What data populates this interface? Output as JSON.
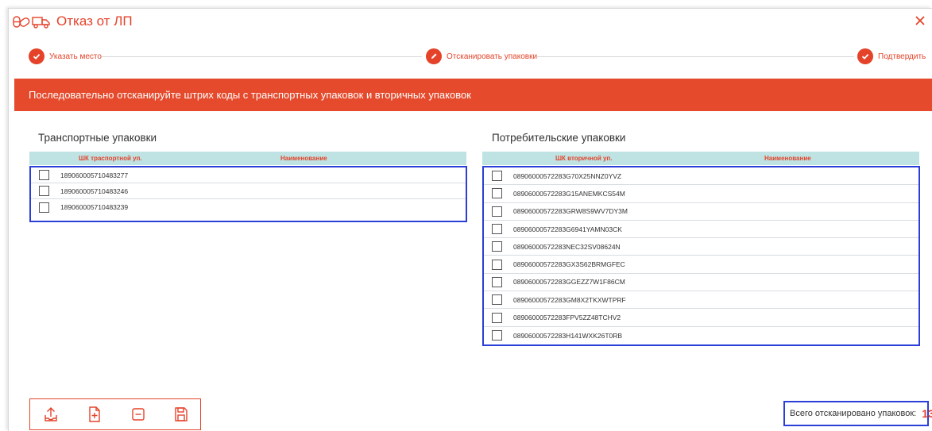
{
  "window": {
    "title": "Отказ от ЛП",
    "icons": [
      "pills-icon",
      "truck-icon"
    ],
    "close_icon": "close-icon"
  },
  "stepper": {
    "steps": [
      {
        "label": "Указать место",
        "icon": "check-icon",
        "state": "done"
      },
      {
        "label": "Отсканировать упаковки",
        "icon": "pencil-icon",
        "state": "active"
      },
      {
        "label": "Подтвердить",
        "icon": "check-icon",
        "state": "done"
      }
    ]
  },
  "banner": {
    "text": "Последовательно отсканируйте штрих коды с транспортных упаковок и вторичных упаковок"
  },
  "transport_panel": {
    "title": "Транспортные упаковки",
    "columns": [
      "ШК траспортной уп.",
      "Наименование"
    ],
    "rows": [
      {
        "code": "189060005710483277",
        "name": "",
        "checked": false
      },
      {
        "code": "189060005710483246",
        "name": "",
        "checked": false
      },
      {
        "code": "189060005710483239",
        "name": "",
        "checked": false
      }
    ]
  },
  "consumer_panel": {
    "title": "Потребительские упаковки",
    "columns": [
      "ШК вторичной уп.",
      "Наименование"
    ],
    "rows": [
      {
        "code": "08906000572283G70X25NNZ0YVZ",
        "name": "",
        "checked": false
      },
      {
        "code": "08906000572283G15ANEMKCS54M",
        "name": "",
        "checked": false
      },
      {
        "code": "08906000572283GRW8S9WV7DY3M",
        "name": "",
        "checked": false
      },
      {
        "code": "08906000572283G6941YAMN03CK",
        "name": "",
        "checked": false
      },
      {
        "code": "08906000572283NEC32SV08624N",
        "name": "",
        "checked": false
      },
      {
        "code": "08906000572283GX3S62BRMGFEC",
        "name": "",
        "checked": false
      },
      {
        "code": "08906000572283GGEZZ7W1F86CM",
        "name": "",
        "checked": false
      },
      {
        "code": "08906000572283GM8X2TKXWTPRF",
        "name": "",
        "checked": false
      },
      {
        "code": "08906000572283FPV5ZZ48TCHV2",
        "name": "",
        "checked": false
      },
      {
        "code": "08906000572283H141WXK26T0RB",
        "name": "",
        "checked": false
      }
    ]
  },
  "toolbar": {
    "buttons": [
      {
        "name": "upload-button",
        "icon": "upload-tray-icon"
      },
      {
        "name": "add-file-button",
        "icon": "file-plus-icon"
      },
      {
        "name": "remove-button",
        "icon": "square-minus-icon"
      },
      {
        "name": "save-button",
        "icon": "floppy-disk-icon"
      }
    ]
  },
  "summary": {
    "label": "Всего отсканировано упаковок:",
    "count": "13"
  },
  "colors": {
    "accent": "#e4432a",
    "banner": "#e54a2c",
    "table_header": "#bfe3e3",
    "highlight_border": "#2b3ed6"
  }
}
